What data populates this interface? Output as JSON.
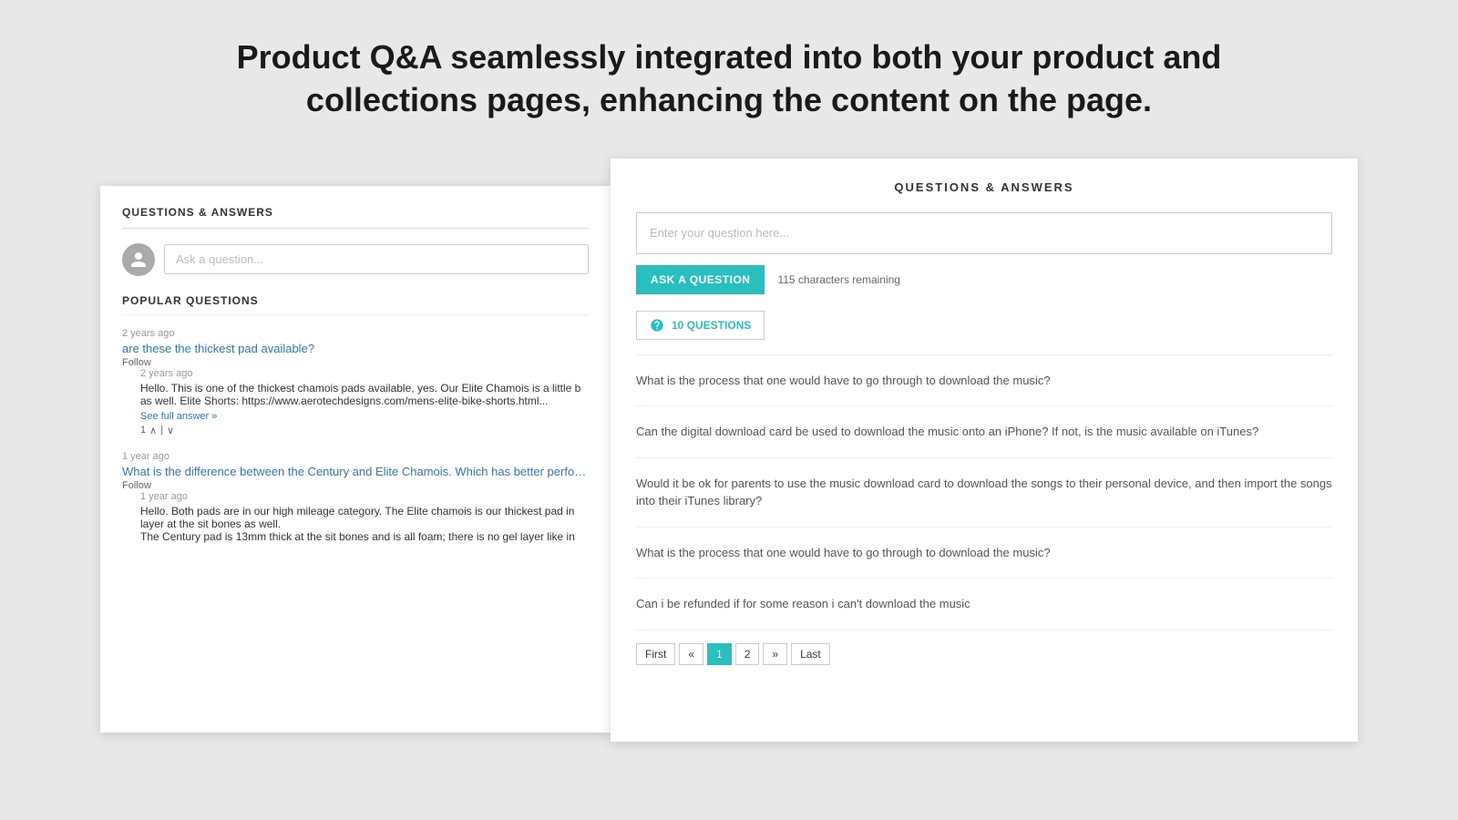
{
  "headline": {
    "line1": "Product Q&A seamlessly integrated into both your  product and",
    "line2": "collections pages, enhancing the content on the page."
  },
  "left_panel": {
    "section_title": "QUESTIONS & ANSWERS",
    "ask_placeholder": "Ask a question...",
    "popular_title": "POPULAR QUESTIONS",
    "questions": [
      {
        "meta": "2 years ago",
        "text": "are these the thickest pad available?",
        "follow": "Follow",
        "answer": {
          "meta": "2 years ago",
          "text": "Hello. This is one of the thickest chamois pads available, yes. Our Elite Chamois is a little b",
          "text2": "as well. Elite Shorts: https://www.aerotechdesigns.com/mens-elite-bike-shorts.html...",
          "see_full": "See full answer »",
          "votes": "1"
        }
      },
      {
        "meta": "1 year ago",
        "text": "What is the difference between the Century and Elite Chamois. Which has better performance f",
        "follow": "Follow",
        "answer": {
          "meta": "1 year ago",
          "text": "Hello. Both pads are in our high mileage category. The Elite chamois is our thickest pad in",
          "text2": "layer at the sit bones as well.",
          "text3": "The Century pad is 13mm thick at the sit bones and is all foam; there is no gel layer like in"
        }
      }
    ]
  },
  "right_panel": {
    "section_title": "QUESTIONS & ANSWERS",
    "question_placeholder": "Enter your question here...",
    "ask_btn_label": "ASK A QUESTION",
    "chars_remaining": "115 characters remaining",
    "questions_tab_label": "10 QUESTIONS",
    "questions": [
      {
        "text": "What is the process that one would have to go through to download the music?"
      },
      {
        "text": "Can the digital download card be used to download the music onto an iPhone? If not, is the music available on iTunes?"
      },
      {
        "text": "Would it be ok for parents to use the music download card to download the songs to their personal device, and then import the songs into their iTunes library?"
      },
      {
        "text": "What is the process that one would have to go through to download the music?"
      },
      {
        "text": "Can i be refunded if for some reason i can't download the music"
      }
    ],
    "pagination": {
      "first": "First",
      "prev": "«",
      "page1": "1",
      "page2": "2",
      "next": "»",
      "last": "Last"
    }
  }
}
